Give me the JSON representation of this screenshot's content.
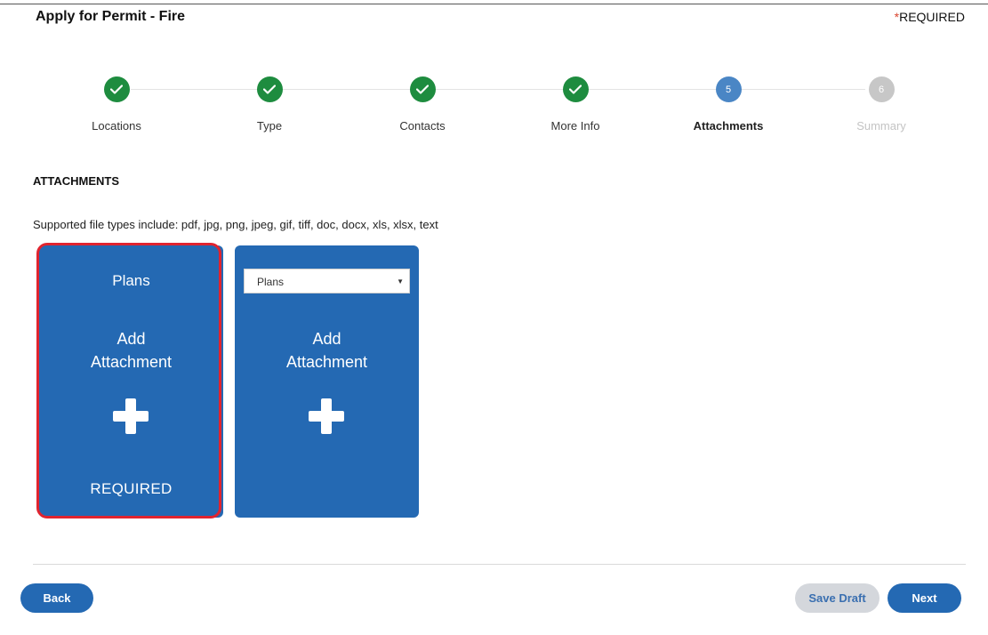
{
  "header": {
    "title": "Apply for Permit - Fire",
    "required_star": "*",
    "required_label": "REQUIRED"
  },
  "stepper": {
    "steps": [
      {
        "label": "Locations",
        "state": "done",
        "icon": "check-icon"
      },
      {
        "label": "Type",
        "state": "done",
        "icon": "check-icon"
      },
      {
        "label": "Contacts",
        "state": "done",
        "icon": "check-icon"
      },
      {
        "label": "More Info",
        "state": "done",
        "icon": "check-icon"
      },
      {
        "label": "Attachments",
        "state": "current",
        "number": "5"
      },
      {
        "label": "Summary",
        "state": "todo",
        "number": "6"
      }
    ]
  },
  "attachments": {
    "section_title": "ATTACHMENTS",
    "supported_text": "Supported file types include: pdf, jpg, png, jpeg, gif, tiff, doc, docx, xls, xlsx, text",
    "cards": [
      {
        "type_label": "Plans",
        "add_line1": "Add",
        "add_line2": "Attachment",
        "required_text": "REQUIRED"
      },
      {
        "select_value": "Plans",
        "add_line1": "Add",
        "add_line2": "Attachment"
      }
    ]
  },
  "footer": {
    "back_label": "Back",
    "save_draft_label": "Save Draft",
    "next_label": "Next"
  },
  "colors": {
    "done": "#1e8c3f",
    "current": "#4a86c5",
    "todo": "#c7c7c7",
    "card": "#2469b3",
    "highlight": "#e0242f"
  }
}
